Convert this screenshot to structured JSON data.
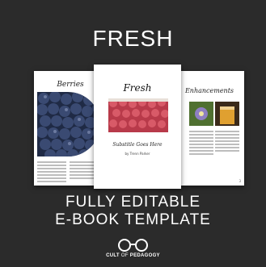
{
  "header": {
    "title": "FRESH"
  },
  "pages": {
    "left": {
      "heading": "Berries"
    },
    "cover": {
      "title": "Fresh",
      "subtitle": "Substitle Goes Here",
      "author": "by Trenn Parker"
    },
    "right": {
      "heading": "Enhancements",
      "page_number": "3"
    }
  },
  "tagline": {
    "line1": "FULLY EDITABLE",
    "line2": "E-BOOK TEMPLATE"
  },
  "brand": {
    "name_part1": "CULT",
    "name_part2": "OF",
    "name_part3": "PEDAGOGY"
  },
  "colors": {
    "background": "#2b2b2b",
    "text": "#ffffff",
    "blueberry": "#2f3a5c",
    "raspberry": "#c74857"
  },
  "icons": {
    "logo": "glasses-icon"
  }
}
